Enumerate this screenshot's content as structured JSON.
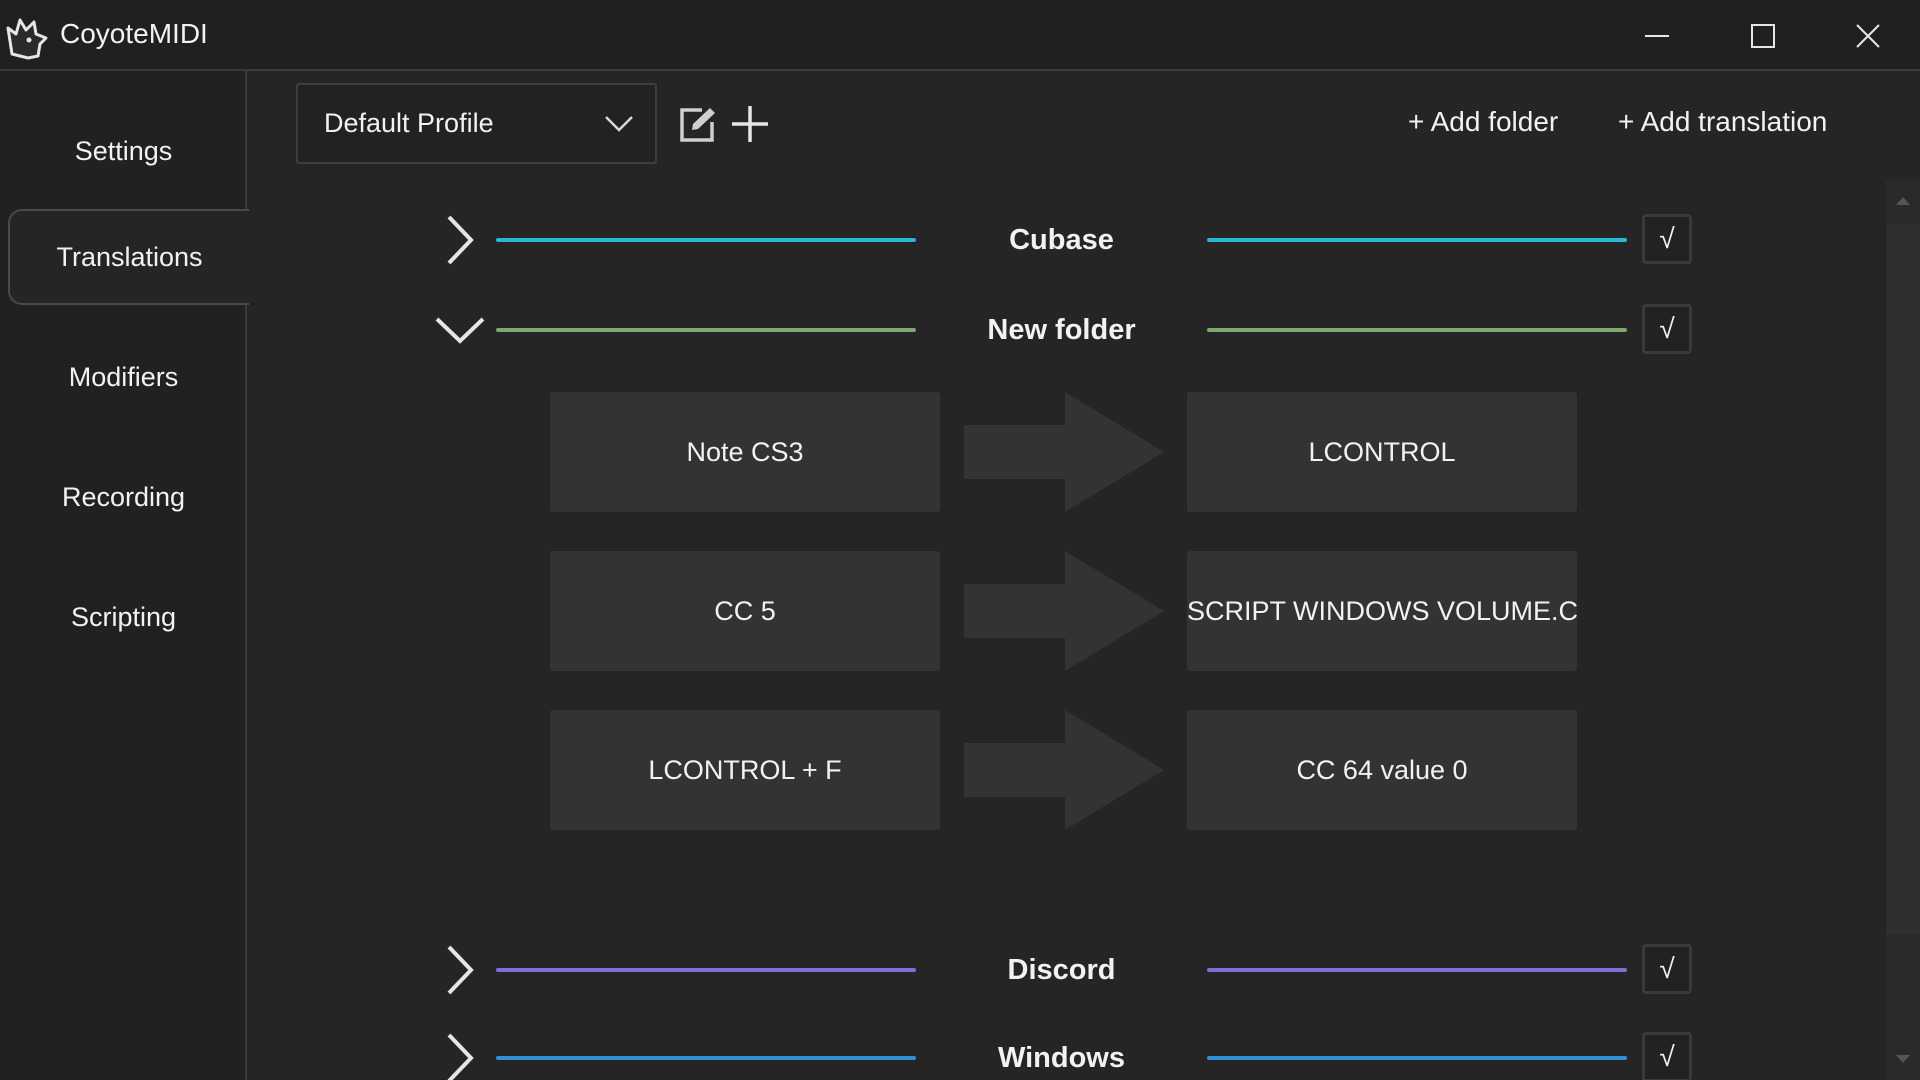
{
  "window": {
    "title": "CoyoteMIDI",
    "icons": {
      "logo": "coyote-logo-icon",
      "minimize": "minimize-icon",
      "maximize": "maximize-icon",
      "close": "close-icon"
    }
  },
  "sidebar": {
    "items": [
      {
        "label": "Settings",
        "active": false
      },
      {
        "label": "Translations",
        "active": true
      },
      {
        "label": "Modifiers",
        "active": false
      },
      {
        "label": "Recording",
        "active": false
      },
      {
        "label": "Scripting",
        "active": false
      }
    ]
  },
  "toolbar": {
    "profile": {
      "selected": "Default Profile",
      "icon": "chevron-down-icon"
    },
    "edit_icon": "edit-icon",
    "add_icon": "plus-icon",
    "add_folder_label": "+ Add folder",
    "add_translation_label": "+ Add translation"
  },
  "folders": [
    {
      "name": "Cubase",
      "expanded": false,
      "enabled_mark": "√",
      "line_color": "#29b6d6"
    },
    {
      "name": "New folder",
      "expanded": true,
      "enabled_mark": "√",
      "line_color": "#7fa870"
    },
    {
      "name": "Discord",
      "expanded": false,
      "enabled_mark": "√",
      "line_color": "#7f6fd6"
    },
    {
      "name": "Windows",
      "expanded": false,
      "enabled_mark": "√",
      "line_color": "#2e8fd6"
    }
  ],
  "translations": [
    {
      "input": "Note CS3",
      "output": "LCONTROL"
    },
    {
      "input": "CC 5",
      "output": "SCRIPT WINDOWS VOLUME.CY"
    },
    {
      "input": "LCONTROL + F",
      "output": "CC 64 value 0"
    }
  ],
  "colors": {
    "background": "#252525",
    "sidebar": "#212121",
    "translation_box": "#333333",
    "arrow": "#333333"
  }
}
